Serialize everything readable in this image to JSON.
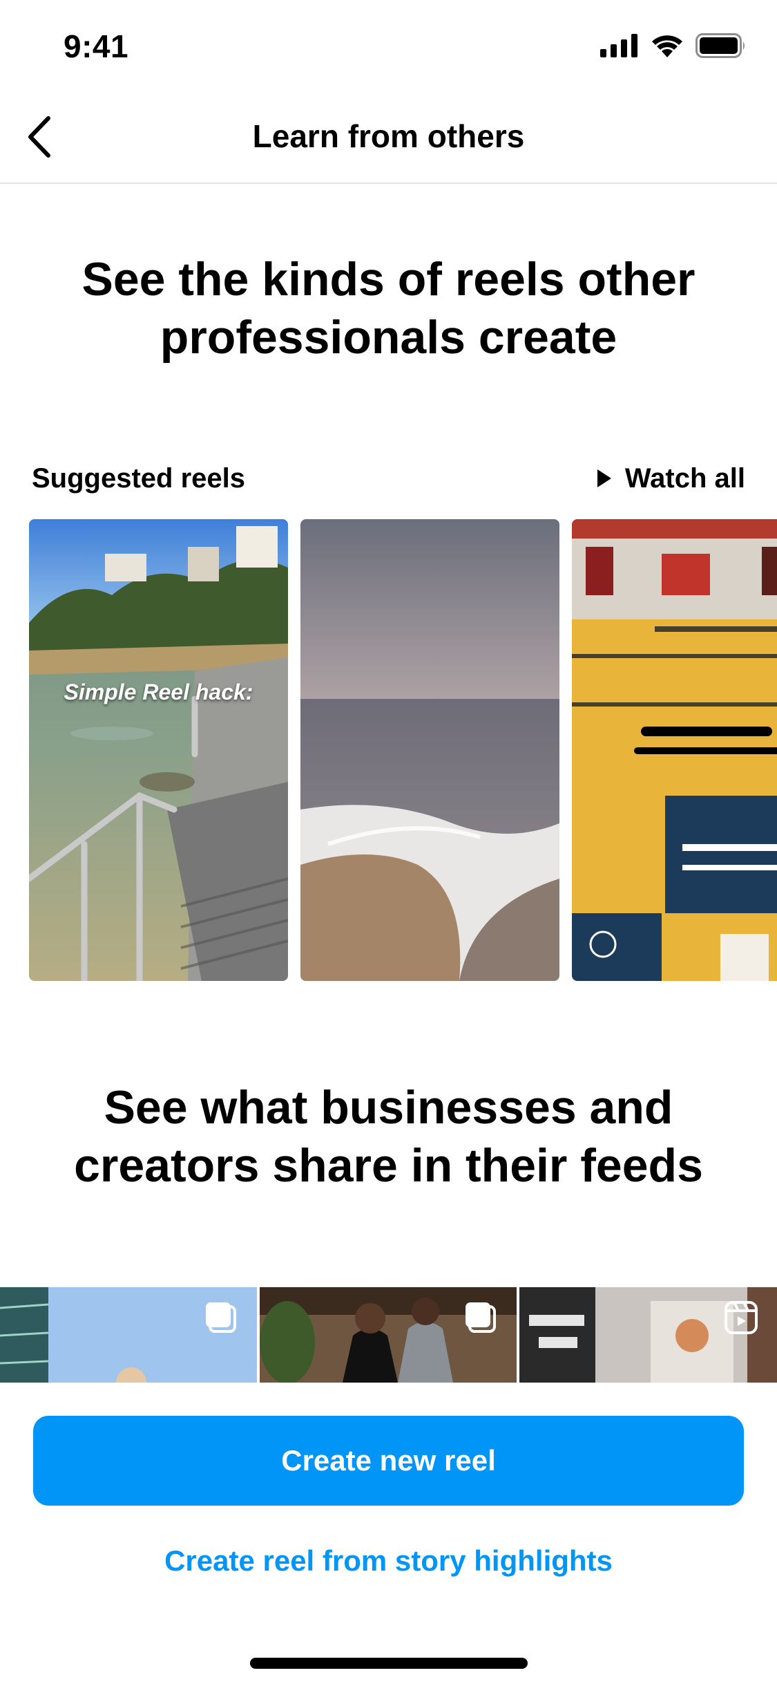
{
  "status_bar": {
    "time": "9:41"
  },
  "nav": {
    "title": "Learn from others"
  },
  "section1": {
    "headline": "See the kinds of reels other professionals create",
    "suggested_label": "Suggested reels",
    "watch_all_label": "Watch all",
    "reels": [
      {
        "overlay_text": "Simple Reel hack:"
      },
      {
        "overlay_text": ""
      },
      {
        "overlay_text": ""
      }
    ]
  },
  "section2": {
    "headline": "See what businesses and creators share in their feeds"
  },
  "actions": {
    "primary_label": "Create new reel",
    "secondary_label": "Create reel from story highlights"
  },
  "colors": {
    "accent": "#0095f6"
  }
}
